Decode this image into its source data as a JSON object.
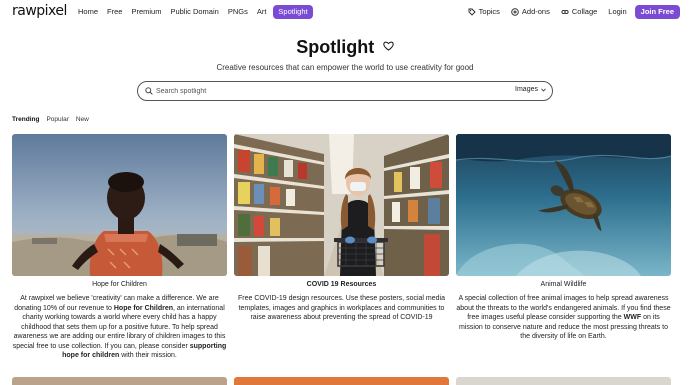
{
  "brand": {
    "logo": "rawpixel",
    "accent": "#7b4bd4"
  },
  "nav": {
    "left_items": [
      {
        "label": "Home",
        "name": "nav-home"
      },
      {
        "label": "Free",
        "name": "nav-free"
      },
      {
        "label": "Premium",
        "name": "nav-premium"
      },
      {
        "label": "Public Domain",
        "name": "nav-public-domain"
      },
      {
        "label": "PNGs",
        "name": "nav-pngs"
      },
      {
        "label": "Art",
        "name": "nav-art"
      }
    ],
    "active_item": "Spotlight",
    "topics": "Topics",
    "addons": "Add-ons",
    "collage": "Collage",
    "login": "Login",
    "join": "Join Free"
  },
  "hero": {
    "title": "Spotlight",
    "subtitle": "Creative resources that can empower the world to use creativity for good"
  },
  "search": {
    "placeholder": "Search spotlight",
    "filter": "Images"
  },
  "tabs": [
    "Trending",
    "Popular",
    "New"
  ],
  "cards": [
    {
      "title": "Hope for Children",
      "desc_1": "At rawpixel we believe 'creativity' can make a difference. We are donating 10% of our revenue to ",
      "desc_b1": "Hope for Children",
      "desc_2": ", an international charity working towards a world where every child has a happy childhood that sets them up for a positive future. To help spread awareness we are adding our entire library of children images to this special free to use collection. If you can, please consider ",
      "desc_b2": "supporting hope for children",
      "desc_3": " with their mission."
    },
    {
      "title": "COVID 19 Resources",
      "desc_1": "Free COVID-19 design resources. Use these posters, social media templates, images and graphics in workplaces and communities to raise awareness about preventing the spread of COVID-19"
    },
    {
      "title": "Animal Wildlife",
      "desc_1": "A special collection of free animal images to help spread awareness about the threats to the world's endangered animals. If you find these free images useful please consider supporting the ",
      "desc_b1": "WWF",
      "desc_2": " on its mission to conserve nature and reduce the most pressing threats to the diversity of life on Earth."
    }
  ]
}
